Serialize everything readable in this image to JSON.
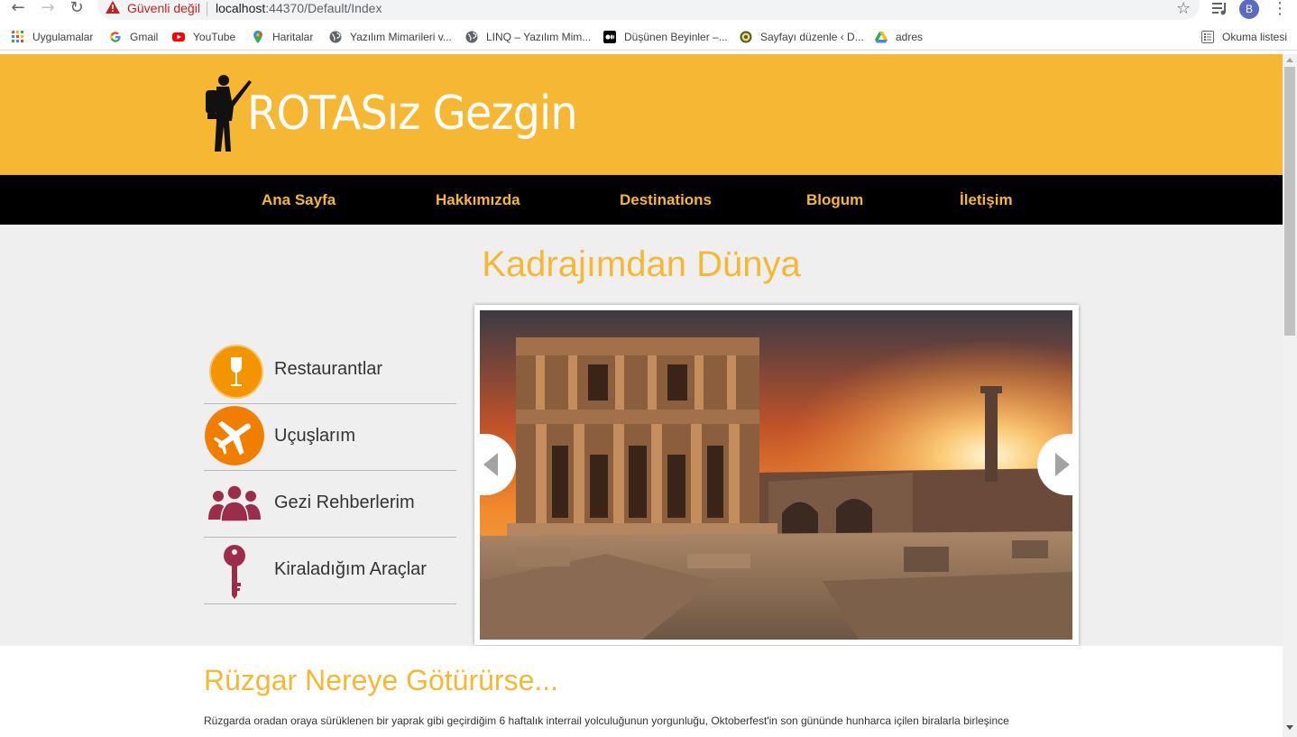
{
  "browser": {
    "security_label": "Güvenli değil",
    "url_host": "localhost",
    "url_path": ":44370/Default/Index",
    "profile_initial": "B",
    "bookmarks": [
      {
        "label": "Uygulamalar",
        "icon": "apps-grid-icon"
      },
      {
        "label": "Gmail",
        "icon": "google-icon"
      },
      {
        "label": "YouTube",
        "icon": "youtube-icon"
      },
      {
        "label": "Haritalar",
        "icon": "maps-pin-icon"
      },
      {
        "label": "Yazılım Mimarileri v...",
        "icon": "globe-icon"
      },
      {
        "label": "LINQ – Yazılım Mim...",
        "icon": "globe-icon"
      },
      {
        "label": "Düşünen Beyinler –...",
        "icon": "medium-icon"
      },
      {
        "label": "Sayfayı düzenle ‹ D...",
        "icon": "wordpress-icon"
      },
      {
        "label": "adres",
        "icon": "drive-icon"
      }
    ],
    "reading_list_label": "Okuma listesi"
  },
  "site": {
    "logo_text": "ROTASız Gezgin",
    "nav": [
      "Ana Sayfa",
      "Hakkımızda",
      "Destinations",
      "Blogum",
      "İletişim"
    ],
    "gallery_title": "Kadrajımdan Dünya",
    "side_items": [
      {
        "label": "Restaurantlar",
        "icon": "wine-glass-icon"
      },
      {
        "label": "Uçuşlarım",
        "icon": "airplane-icon"
      },
      {
        "label": "Gezi Rehberlerim",
        "icon": "people-group-icon"
      },
      {
        "label": "Kiraladığım Araçlar",
        "icon": "key-icon"
      }
    ],
    "article_title": "Rüzgar Nereye Götürürse...",
    "article_text": "Rüzgarda oradan oraya sürüklenen bir yaprak gibi geçirdiğim 6 haftalık interrail yolculuğunun yorgunluğu, Oktoberfest'in son gününde hunharca içilen biralarla birleşince"
  },
  "colors": {
    "brand_yellow": "#f6b733",
    "nav_black": "#000000",
    "gallery_bg": "#efefef",
    "icon_orange": "#f08a00",
    "icon_maroon": "#9b2d4a"
  }
}
